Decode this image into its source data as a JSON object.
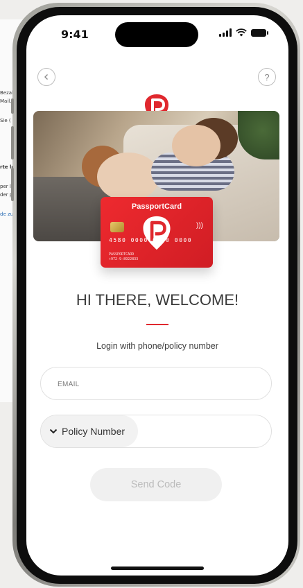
{
  "background_page": {
    "snippets": [
      "Bezah",
      "Mail.",
      "Sie (",
      "rte le",
      "per l",
      "der p",
      "de zu"
    ]
  },
  "status_bar": {
    "time": "9:41"
  },
  "nav": {
    "back_icon": "chevron-left-icon",
    "help_label": "?"
  },
  "card": {
    "brand": "PassportCard",
    "number": "4580 0000 0000 0000",
    "holder_lines": [
      "PASSPORTCARD",
      "+972-9-8922833"
    ]
  },
  "welcome": {
    "title": "HI THERE, WELCOME!",
    "subtitle": "Login with phone/policy number"
  },
  "form": {
    "email_placeholder": "EMAIL",
    "policy_selector_label": "Policy Number",
    "send_label": "Send Code"
  },
  "colors": {
    "brand_red": "#e0282e",
    "button_disabled": "#f0f0f0"
  }
}
